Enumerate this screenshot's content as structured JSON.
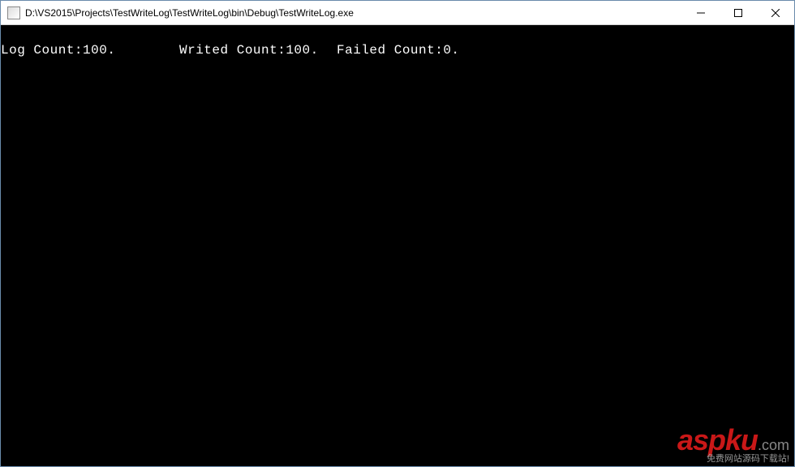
{
  "window": {
    "title": "D:\\VS2015\\Projects\\TestWriteLog\\TestWriteLog\\bin\\Debug\\TestWriteLog.exe"
  },
  "console": {
    "log_count_label": "Log Count:",
    "log_count_value": "100.",
    "writed_count_label": "Writed Count:",
    "writed_count_value": "100.",
    "failed_count_label": "Failed Count:",
    "failed_count_value": "0."
  },
  "watermark": {
    "brand": "aspku",
    "suffix": ".com",
    "tagline": "免费网站源码下载站!"
  }
}
